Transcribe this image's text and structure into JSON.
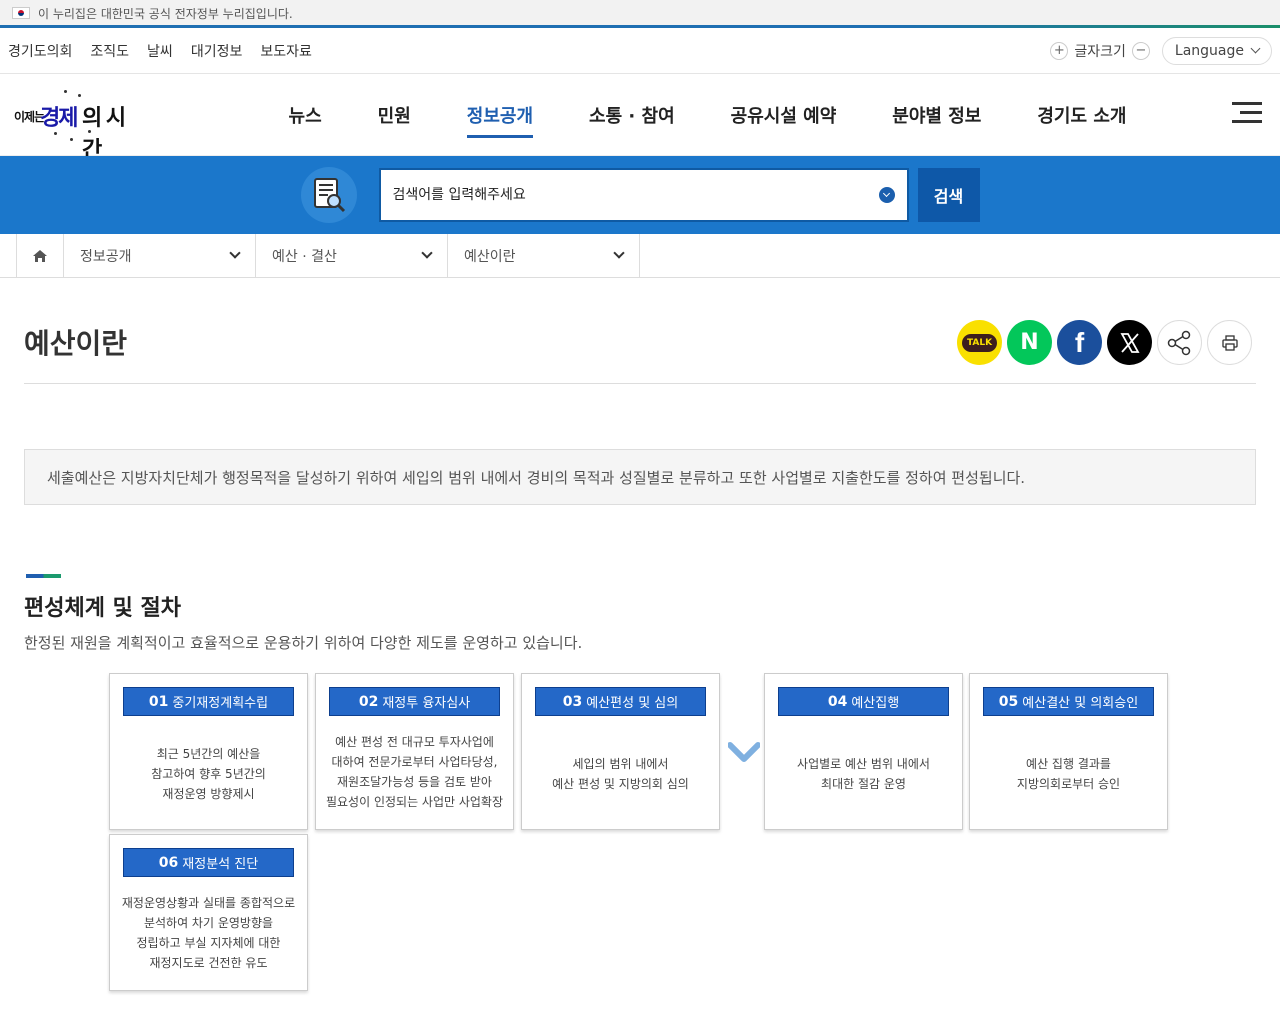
{
  "gov_banner": {
    "text": "이 누리집은 대한민국 공식 전자정부 누리집입니다."
  },
  "util_links": [
    "경기도의회",
    "조직도",
    "날씨",
    "대기정보",
    "보도자료"
  ],
  "fontsize": {
    "label": "글자크기",
    "plus": "+",
    "minus": "−"
  },
  "language": {
    "label": "Language"
  },
  "logo": {
    "part1": "이제는",
    "part2": "경제",
    "part3": "의 시간"
  },
  "gnb": [
    {
      "label": "뉴스"
    },
    {
      "label": "민원"
    },
    {
      "label": "정보공개"
    },
    {
      "label": "소통 · 참여"
    },
    {
      "label": "공유시설 예약"
    },
    {
      "label": "분야별 정보"
    },
    {
      "label": "경기도 소개"
    }
  ],
  "search": {
    "placeholder": "검색어를 입력해주세요",
    "button": "검색"
  },
  "breadcrumb": [
    "정보공개",
    "예산 · 결산",
    "예산이란"
  ],
  "page_title": "예산이란",
  "share": {
    "kakao": "TALK",
    "naver": "N",
    "facebook": "f"
  },
  "notice": "세출예산은 지방자치단체가 행정목적을 달성하기 위하여 세입의 범위 내에서 경비의 목적과 성질별로 분류하고 또한 사업별로 지출한도를 정하여 편성됩니다.",
  "section": {
    "title": "편성체계 및 절차",
    "desc": "한정된 재원을 계획적이고 효율적으로 운용하기 위하여 다양한 제도를 운영하고 있습니다."
  },
  "steps": [
    {
      "num": "01",
      "title": "중기재정계획수립",
      "body": "최근 5년간의 예산을\n참고하여 향후 5년간의\n재정운영 방향제시"
    },
    {
      "num": "02",
      "title": "재정투 융자심사",
      "body": "예산 편성 전 대규모 투자사업에\n대하여 전문가로부터 사업타당성,\n재원조달가능성 등을 검토 받아\n필요성이 인정되는 사업만 사업확장"
    },
    {
      "num": "03",
      "title": "예산편성 및 심의",
      "body": "세입의 범위 내에서\n예산 편성 및 지방의회 심의"
    },
    {
      "num": "04",
      "title": "예산집행",
      "body": "사업별로 예산 범위 내에서\n최대한 절감 운영"
    },
    {
      "num": "05",
      "title": "예산결산 및 의회승인",
      "body": "예산 집행 결과를\n지방의회로부터 승인"
    },
    {
      "num": "06",
      "title": "재정분석 진단",
      "body": "재정운영상황과 실태를 종합적으로\n분석하여 차기 운영방향을\n정립하고 부실 지자체에 대한\n재정지도로 건전한 유도"
    }
  ]
}
